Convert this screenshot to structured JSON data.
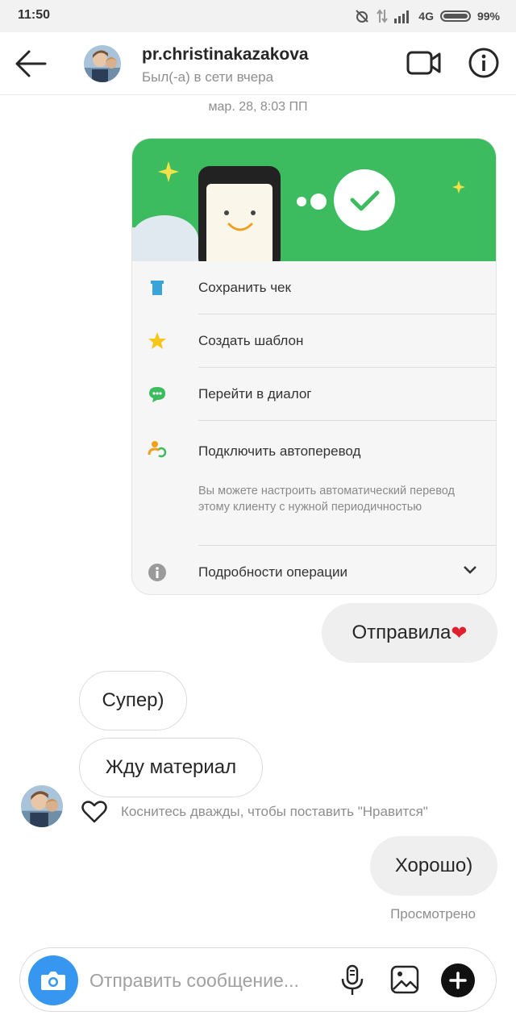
{
  "status_bar": {
    "time": "11:50",
    "network": "4G",
    "battery": "99%"
  },
  "header": {
    "username": "pr.christinakazakova",
    "presence": "Был(-а) в сети вчера"
  },
  "thread": {
    "timestamp": "мар. 28, 8:03 ПП",
    "shared_image": {
      "rows": [
        {
          "label": "Сохранить чек",
          "icon": "receipt-icon"
        },
        {
          "label": "Создать шаблон",
          "icon": "star-icon"
        },
        {
          "label": "Перейти в диалог",
          "icon": "chat-icon"
        },
        {
          "label": "Подключить автоперевод",
          "icon": "autotransfer-icon"
        }
      ],
      "autotransfer_description": "Вы можете настроить автоматический перевод этому клиенту с нужной периодичностью",
      "details_label": "Подробности операции"
    },
    "messages": [
      {
        "side": "out",
        "text": "Отправила",
        "emoji": "❤"
      },
      {
        "side": "in",
        "text": "Супер)"
      },
      {
        "side": "in",
        "text": "Жду материал"
      },
      {
        "side": "out",
        "text": "Хорошо)"
      }
    ],
    "like_hint": "Коснитесь дважды, чтобы поставить \"Нравится\"",
    "seen_label": "Просмотрено"
  },
  "composer": {
    "placeholder": "Отправить сообщение..."
  },
  "colors": {
    "accent_blue": "#3797f0",
    "banner_green": "#3dbb5f",
    "heart_red": "#e0202f"
  }
}
